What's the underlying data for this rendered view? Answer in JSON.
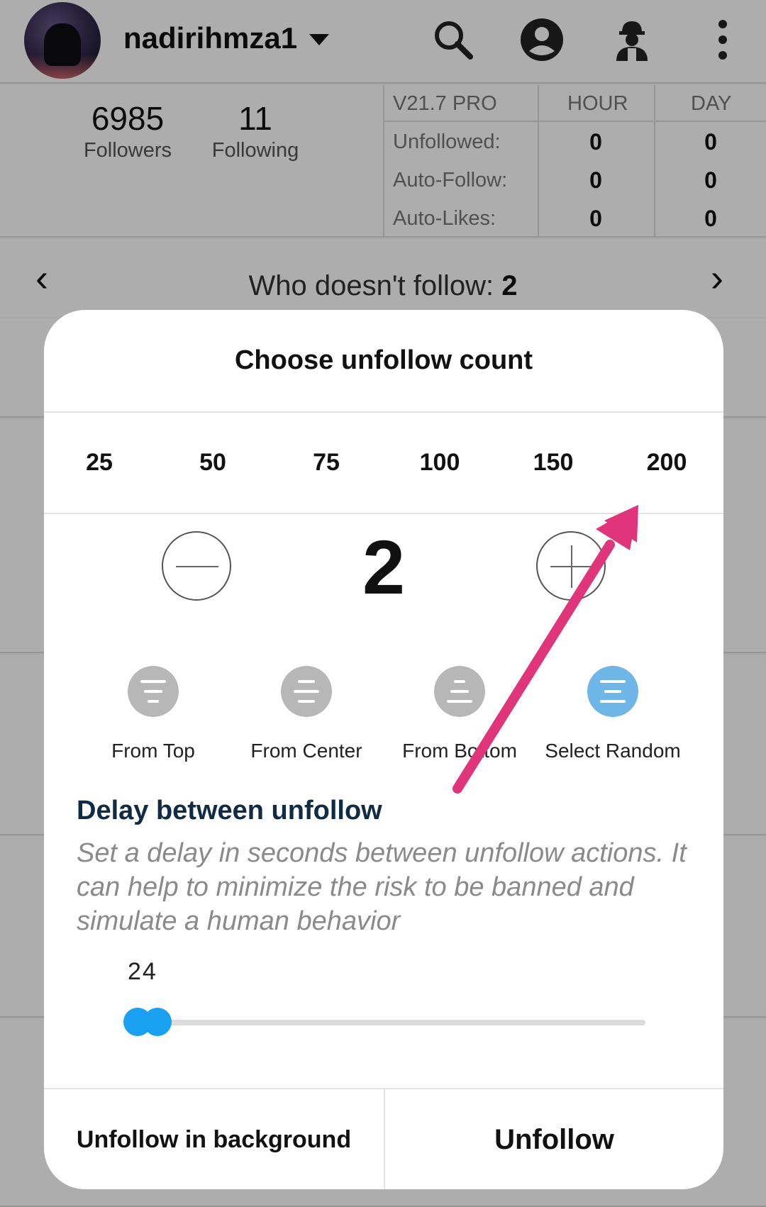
{
  "header": {
    "username": "nadirihmza1",
    "icons": [
      "search-icon",
      "account-icon",
      "worker-icon",
      "more-vert-icon"
    ]
  },
  "stats": {
    "followers_count": "6985",
    "followers_label": "Followers",
    "following_count": "11",
    "following_label": "Following",
    "table": {
      "version": "V21.7 PRO",
      "col_hour": "HOUR",
      "col_day": "DAY",
      "rows": [
        {
          "label": "Unfollowed:",
          "hour": "0",
          "day": "0"
        },
        {
          "label": "Auto-Follow:",
          "hour": "0",
          "day": "0"
        },
        {
          "label": "Auto-Likes:",
          "hour": "0",
          "day": "0"
        }
      ]
    }
  },
  "nav": {
    "label": "Who doesn't follow:",
    "count": "2"
  },
  "dialog": {
    "title": "Choose unfollow count",
    "presets": [
      "25",
      "50",
      "75",
      "100",
      "150",
      "200"
    ],
    "count": "2",
    "modes": [
      {
        "label": "From Top",
        "selected": false
      },
      {
        "label": "From Center",
        "selected": false
      },
      {
        "label": "From Bottom",
        "selected": false
      },
      {
        "label": "Select Random",
        "selected": true
      }
    ],
    "delay_title": "Delay between unfollow",
    "delay_description": "Set a delay in seconds between unfollow actions. It can help to minimize the risk to be banned and simulate a human behavior",
    "slider_value": "24",
    "btn_background": "Unfollow in background",
    "btn_unfollow": "Unfollow"
  },
  "colors": {
    "accent_blue": "#1aa0f0",
    "selected_mode": "#6fb6e8",
    "annotation_arrow": "#e0357a",
    "delay_title": "#0f2b45"
  }
}
